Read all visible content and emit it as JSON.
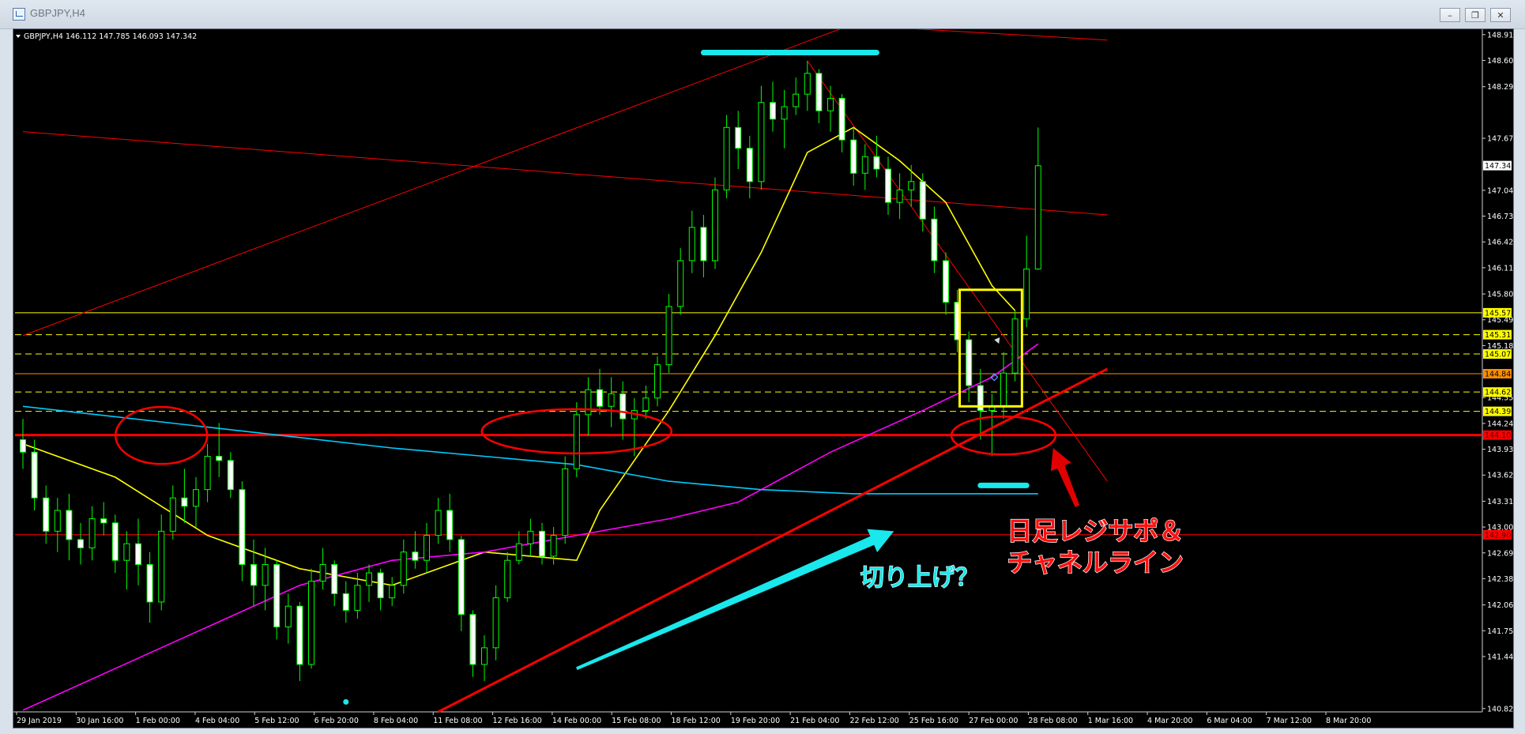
{
  "window": {
    "title": "GBPJPY,H4",
    "buttons": [
      "minimize",
      "restore",
      "close"
    ]
  },
  "chart_data": {
    "type": "candlestick",
    "info_line": "GBPJPY,H4  146.112 147.785 146.093 147.342",
    "y_ticks": [
      "148.915",
      "148.605",
      "148.290",
      "147.670",
      "147.045",
      "146.735",
      "146.425",
      "146.115",
      "145.800",
      "145.490",
      "145.180",
      "144.555",
      "144.245",
      "143.935",
      "143.625",
      "143.310",
      "143.000",
      "142.690",
      "142.380",
      "142.065",
      "141.755",
      "141.445",
      "140.820"
    ],
    "ylim": [
      140.78,
      148.98
    ],
    "x_ticks": [
      "29 Jan 2019",
      "30 Jan 16:00",
      "1 Feb 00:00",
      "4 Feb 04:00",
      "5 Feb 12:00",
      "6 Feb 20:00",
      "8 Feb 04:00",
      "11 Feb 08:00",
      "12 Feb 16:00",
      "14 Feb 00:00",
      "15 Feb 08:00",
      "18 Feb 12:00",
      "19 Feb 20:00",
      "21 Feb 04:00",
      "22 Feb 12:00",
      "25 Feb 16:00",
      "27 Feb 00:00",
      "28 Feb 08:00",
      "1 Mar 16:00",
      "4 Mar 20:00",
      "6 Mar 04:00",
      "7 Mar 12:00",
      "8 Mar 20:00"
    ],
    "price_labels": [
      {
        "value": 147.342,
        "text": "147.342",
        "bg": "#ffffff",
        "fg": "#000000"
      },
      {
        "value": 145.574,
        "text": "145.574",
        "bg": "#ffff00",
        "fg": "#000000"
      },
      {
        "value": 145.311,
        "text": "145.311",
        "bg": "#ffff00",
        "fg": "#000000"
      },
      {
        "value": 145.079,
        "text": "145.079",
        "bg": "#ffff00",
        "fg": "#000000"
      },
      {
        "value": 144.842,
        "text": "144.842",
        "bg": "#ff8c00",
        "fg": "#000000"
      },
      {
        "value": 144.622,
        "text": "144.622",
        "bg": "#ffff00",
        "fg": "#000000"
      },
      {
        "value": 144.39,
        "text": "144.390",
        "bg": "#ffff00",
        "fg": "#000000"
      },
      {
        "value": 144.105,
        "text": "144.105",
        "bg": "#ff0000",
        "fg": "#5a0000"
      },
      {
        "value": 142.908,
        "text": "142.908",
        "bg": "#ff0000",
        "fg": "#5a0000"
      }
    ],
    "hlines": [
      {
        "value": 145.574,
        "color": "#ffff00",
        "style": "solid",
        "width": 1
      },
      {
        "value": 145.311,
        "color": "#ffff00",
        "style": "dashed",
        "width": 1
      },
      {
        "value": 145.079,
        "color": "#ffff00",
        "style": "dashed",
        "width": 1
      },
      {
        "value": 144.842,
        "color": "#ff8c00",
        "style": "solid",
        "width": 1
      },
      {
        "value": 144.622,
        "color": "#ffff00",
        "style": "dashed",
        "width": 1
      },
      {
        "value": 144.39,
        "color": "#ffff00",
        "style": "dashed",
        "width": 1
      },
      {
        "value": 144.105,
        "color": "#ff0000",
        "style": "solid",
        "width": 3
      },
      {
        "value": 142.908,
        "color": "#ff0000",
        "style": "solid",
        "width": 1
      }
    ],
    "candles": [
      [
        144.05,
        144.3,
        143.7,
        143.9
      ],
      [
        143.9,
        144.05,
        143.2,
        143.35
      ],
      [
        143.35,
        143.5,
        142.8,
        142.95
      ],
      [
        142.95,
        143.35,
        142.7,
        143.2
      ],
      [
        143.2,
        143.4,
        142.6,
        142.85
      ],
      [
        142.85,
        143.05,
        142.55,
        142.75
      ],
      [
        142.75,
        143.25,
        142.6,
        143.1
      ],
      [
        143.1,
        143.3,
        142.9,
        143.05
      ],
      [
        143.05,
        143.15,
        142.45,
        142.6
      ],
      [
        142.6,
        142.95,
        142.25,
        142.8
      ],
      [
        142.8,
        143.1,
        142.3,
        142.55
      ],
      [
        142.55,
        142.7,
        141.85,
        142.1
      ],
      [
        142.1,
        143.15,
        142.0,
        142.95
      ],
      [
        142.95,
        143.5,
        142.85,
        143.35
      ],
      [
        143.35,
        143.7,
        143.05,
        143.25
      ],
      [
        143.25,
        143.6,
        143.0,
        143.45
      ],
      [
        143.45,
        144.0,
        143.3,
        143.85
      ],
      [
        143.85,
        144.25,
        143.6,
        143.8
      ],
      [
        143.8,
        143.9,
        143.35,
        143.45
      ],
      [
        143.45,
        143.55,
        142.35,
        142.55
      ],
      [
        142.55,
        142.85,
        142.05,
        142.3
      ],
      [
        142.3,
        142.75,
        142.0,
        142.55
      ],
      [
        142.55,
        142.6,
        141.65,
        141.8
      ],
      [
        141.8,
        142.2,
        141.6,
        142.05
      ],
      [
        142.05,
        142.1,
        141.15,
        141.35
      ],
      [
        141.35,
        142.5,
        141.3,
        142.35
      ],
      [
        142.35,
        142.75,
        142.25,
        142.55
      ],
      [
        142.55,
        142.6,
        142.05,
        142.2
      ],
      [
        142.2,
        142.35,
        141.85,
        142.0
      ],
      [
        142.0,
        142.45,
        141.9,
        142.3
      ],
      [
        142.3,
        142.55,
        142.1,
        142.45
      ],
      [
        142.45,
        142.5,
        142.0,
        142.15
      ],
      [
        142.15,
        142.4,
        142.05,
        142.3
      ],
      [
        142.3,
        142.85,
        142.2,
        142.7
      ],
      [
        142.7,
        142.95,
        142.5,
        142.6
      ],
      [
        142.6,
        143.05,
        142.45,
        142.9
      ],
      [
        142.9,
        143.35,
        142.8,
        143.2
      ],
      [
        143.2,
        143.4,
        142.7,
        142.85
      ],
      [
        142.85,
        142.9,
        141.75,
        141.95
      ],
      [
        141.95,
        142.0,
        141.2,
        141.35
      ],
      [
        141.35,
        141.7,
        141.15,
        141.55
      ],
      [
        141.55,
        142.3,
        141.4,
        142.15
      ],
      [
        142.15,
        142.7,
        142.1,
        142.6
      ],
      [
        142.6,
        142.95,
        142.55,
        142.8
      ],
      [
        142.8,
        143.1,
        142.65,
        142.95
      ],
      [
        142.95,
        143.05,
        142.55,
        142.65
      ],
      [
        142.65,
        143.0,
        142.55,
        142.9
      ],
      [
        142.9,
        143.85,
        142.8,
        143.7
      ],
      [
        143.7,
        144.5,
        143.6,
        144.35
      ],
      [
        144.35,
        144.8,
        144.1,
        144.65
      ],
      [
        144.65,
        144.9,
        144.35,
        144.45
      ],
      [
        144.45,
        144.8,
        144.2,
        144.6
      ],
      [
        144.6,
        144.75,
        144.05,
        144.3
      ],
      [
        144.3,
        144.55,
        143.85,
        144.4
      ],
      [
        144.4,
        144.7,
        144.3,
        144.55
      ],
      [
        144.55,
        145.05,
        144.45,
        144.95
      ],
      [
        144.95,
        145.8,
        144.85,
        145.65
      ],
      [
        145.65,
        146.35,
        145.55,
        146.2
      ],
      [
        146.2,
        146.8,
        146.05,
        146.6
      ],
      [
        146.6,
        146.75,
        146.0,
        146.2
      ],
      [
        146.2,
        147.2,
        146.1,
        147.05
      ],
      [
        147.05,
        147.95,
        146.95,
        147.8
      ],
      [
        147.8,
        148.0,
        147.3,
        147.55
      ],
      [
        147.55,
        147.7,
        146.95,
        147.15
      ],
      [
        147.15,
        148.3,
        147.05,
        148.1
      ],
      [
        148.1,
        148.35,
        147.75,
        147.9
      ],
      [
        147.9,
        148.25,
        147.55,
        148.05
      ],
      [
        148.05,
        148.4,
        147.95,
        148.2
      ],
      [
        148.2,
        148.6,
        148.0,
        148.45
      ],
      [
        148.45,
        148.5,
        147.85,
        148.0
      ],
      [
        148.0,
        148.3,
        147.75,
        148.15
      ],
      [
        148.15,
        148.2,
        147.5,
        147.65
      ],
      [
        147.65,
        147.8,
        147.1,
        147.25
      ],
      [
        147.25,
        147.6,
        147.05,
        147.45
      ],
      [
        147.45,
        147.7,
        147.2,
        147.3
      ],
      [
        147.3,
        147.45,
        146.75,
        146.9
      ],
      [
        146.9,
        147.25,
        146.7,
        147.05
      ],
      [
        147.05,
        147.35,
        146.85,
        147.15
      ],
      [
        147.15,
        147.25,
        146.55,
        146.7
      ],
      [
        146.7,
        146.85,
        146.05,
        146.2
      ],
      [
        146.2,
        146.3,
        145.55,
        145.7
      ],
      [
        145.7,
        145.85,
        145.1,
        145.25
      ],
      [
        145.25,
        145.35,
        144.5,
        144.7
      ],
      [
        144.7,
        144.9,
        144.05,
        144.4
      ],
      [
        144.4,
        144.6,
        143.85,
        144.45
      ],
      [
        144.45,
        145.1,
        144.3,
        144.85
      ],
      [
        144.85,
        145.6,
        144.75,
        145.5
      ],
      [
        145.5,
        146.5,
        145.4,
        146.1
      ],
      [
        146.1,
        147.8,
        146.09,
        147.34
      ]
    ],
    "series": [
      {
        "type": "ma",
        "color": "#ffff00",
        "points": [
          [
            0,
            144.0
          ],
          [
            8,
            143.6
          ],
          [
            16,
            142.9
          ],
          [
            24,
            142.5
          ],
          [
            32,
            142.3
          ],
          [
            40,
            142.7
          ],
          [
            48,
            142.6
          ],
          [
            50,
            143.2
          ],
          [
            56,
            144.4
          ],
          [
            60,
            145.3
          ],
          [
            64,
            146.3
          ],
          [
            68,
            147.5
          ],
          [
            72,
            147.8
          ],
          [
            76,
            147.4
          ],
          [
            80,
            146.9
          ],
          [
            84,
            145.9
          ],
          [
            86,
            145.6
          ]
        ]
      },
      {
        "type": "ma",
        "color": "#ff00ff",
        "points": [
          [
            0,
            140.8
          ],
          [
            8,
            141.3
          ],
          [
            16,
            141.8
          ],
          [
            24,
            142.3
          ],
          [
            32,
            142.6
          ],
          [
            40,
            142.7
          ],
          [
            48,
            142.9
          ],
          [
            56,
            143.1
          ],
          [
            62,
            143.3
          ],
          [
            70,
            143.9
          ],
          [
            78,
            144.4
          ],
          [
            84,
            144.8
          ],
          [
            88,
            145.2
          ]
        ]
      },
      {
        "type": "ma",
        "color": "#00ccff",
        "points": [
          [
            0,
            144.45
          ],
          [
            16,
            144.2
          ],
          [
            32,
            143.95
          ],
          [
            48,
            143.75
          ],
          [
            56,
            143.55
          ],
          [
            64,
            143.45
          ],
          [
            72,
            143.4
          ],
          [
            80,
            143.4
          ],
          [
            88,
            143.4
          ]
        ]
      }
    ],
    "trendlines": [
      {
        "p1": [
          0,
          147.75
        ],
        "p2": [
          94,
          146.75
        ],
        "color": "#ff0000",
        "width": 1
      },
      {
        "p1": [
          0,
          145.3
        ],
        "p2": [
          75,
          149.2
        ],
        "color": "#ff0000",
        "width": 1
      },
      {
        "p1": [
          63,
          149.1
        ],
        "p2": [
          94,
          148.85
        ],
        "color": "#ff0000",
        "width": 1
      },
      {
        "p1": [
          68,
          148.6
        ],
        "p2": [
          94,
          143.55
        ],
        "color": "#ff0000",
        "width": 1
      },
      {
        "p1": [
          36,
          140.78
        ],
        "p2": [
          94,
          144.9
        ],
        "color": "#ff0000",
        "width": 3
      }
    ],
    "annotations": {
      "note_support": "日足レジサポ＆\nチャネルライン",
      "note_higher_low": "切り上げ？"
    }
  }
}
